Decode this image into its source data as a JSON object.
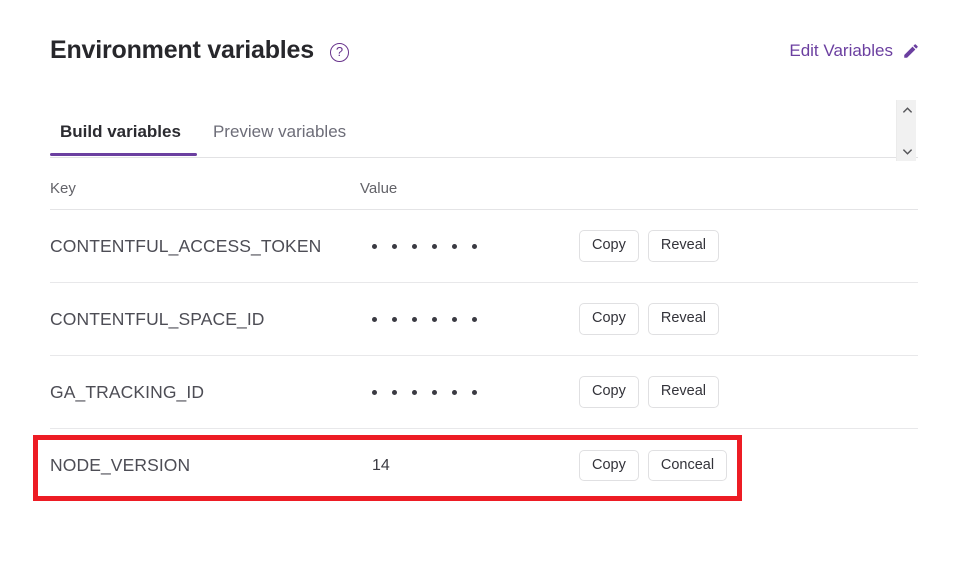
{
  "header": {
    "title": "Environment variables",
    "help_icon": "question-circle-icon",
    "help_glyph": "?",
    "edit_label": "Edit Variables",
    "edit_icon": "pencil-icon"
  },
  "tabs": [
    {
      "label": "Build variables",
      "active": true
    },
    {
      "label": "Preview variables",
      "active": false
    }
  ],
  "scrollbar": {
    "up_icon": "chevron-up-icon",
    "down_icon": "chevron-down-icon"
  },
  "table": {
    "columns": [
      "Key",
      "Value"
    ],
    "rows": [
      {
        "key": "CONTENTFUL_ACCESS_TOKEN",
        "value": "••••••",
        "masked": true,
        "dot_count": 6,
        "buttons": [
          "Copy",
          "Reveal"
        ]
      },
      {
        "key": "CONTENTFUL_SPACE_ID",
        "value": "••••••",
        "masked": true,
        "dot_count": 6,
        "buttons": [
          "Copy",
          "Reveal"
        ]
      },
      {
        "key": "GA_TRACKING_ID",
        "value": "••••••",
        "masked": true,
        "dot_count": 6,
        "buttons": [
          "Copy",
          "Reveal"
        ]
      },
      {
        "key": "NODE_VERSION",
        "value": "14",
        "masked": false,
        "dot_count": 0,
        "buttons": [
          "Copy",
          "Conceal"
        ]
      }
    ]
  },
  "annotation": {
    "type": "highlight-rectangle",
    "color": "#ed1c24",
    "target_row_key": "NODE_VERSION"
  },
  "colors": {
    "accent_purple": "#6b3fa0",
    "title_dark": "#27272b",
    "muted_gray": "#6d6d78",
    "annotation_red": "#ed1c24"
  }
}
